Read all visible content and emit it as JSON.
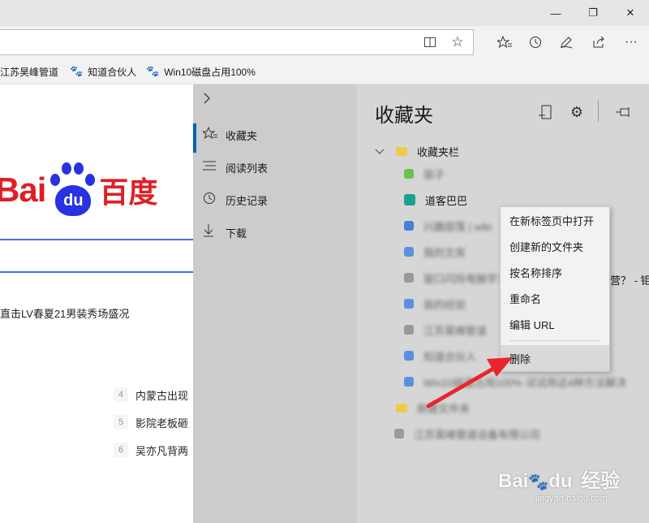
{
  "window": {
    "minimize_glyph": "—",
    "maximize_glyph": "❐",
    "close_glyph": "✕"
  },
  "toolbar": {
    "reading_view_glyph": "📖",
    "favorite_star_glyph": "☆",
    "favorites_glyph": "✩",
    "history_glyph": "🕘",
    "notes_glyph": "✎",
    "share_glyph": "⇪",
    "more_glyph": "···"
  },
  "favorites_bar": {
    "items": [
      {
        "label": "江苏昊峰管道",
        "icon": "baidu-paw-icon"
      },
      {
        "label": "知道合伙人",
        "icon": "baidu-paw-icon"
      },
      {
        "label": "Win10磁盘占用100%",
        "icon": "baidu-paw-icon"
      }
    ]
  },
  "page": {
    "logo_latin": "Bai",
    "logo_du": "du",
    "logo_cn": "百度",
    "news_line": "直击LV春夏21男装秀场盛况",
    "hot_list": [
      {
        "num": "4",
        "text": "内蒙古出现"
      },
      {
        "num": "5",
        "text": "影院老板砸"
      },
      {
        "num": "6",
        "text": "吴亦凡背两"
      }
    ]
  },
  "hub": {
    "expand_glyph": "›",
    "nav": [
      {
        "label": "收藏夹",
        "icon": "star-list-icon",
        "glyph": "☆"
      },
      {
        "label": "阅读列表",
        "icon": "reading-list-icon",
        "glyph": "☰"
      },
      {
        "label": "历史记录",
        "icon": "history-icon",
        "glyph": "↺"
      },
      {
        "label": "下载",
        "icon": "download-icon",
        "glyph": "↓"
      }
    ]
  },
  "favorites_pane": {
    "title": "收藏夹",
    "add_glyph": "⊞",
    "settings_glyph": "⚙",
    "pin_glyph": "⊣",
    "root_folder": "收藏夹栏",
    "items": [
      {
        "label": "丽子",
        "blurred": true,
        "color": "#6cc24a"
      },
      {
        "label": "道客巴巴",
        "blurred": false,
        "color": "#1aa38c"
      },
      {
        "label": "兴趣部落 | wiki",
        "blurred": true,
        "color": "#4a7fd4"
      },
      {
        "label": "我的文库",
        "blurred": true,
        "color": "#5a8fe0"
      },
      {
        "label": "窗口闪烁电脑学习网",
        "blurred": true,
        "color": "#9a9a9a"
      },
      {
        "label": "我的经验",
        "blurred": true,
        "color": "#5a8fe0"
      },
      {
        "label": "江苏昊峰管道",
        "blurred": true,
        "color": "#9a9a9a"
      },
      {
        "label": "知道合伙人",
        "blurred": true,
        "color": "#5a8fe0"
      },
      {
        "label": "Win10磁盘占用100% 试试用这4种方法解决",
        "blurred": true,
        "color": "#5a8fe0"
      },
      {
        "label": "新建文件夹",
        "blurred": true,
        "color": "#f3c94b"
      },
      {
        "label": "江苏昊峰管道设备有限公司",
        "blurred": true,
        "color": "#9a9a9a"
      }
    ]
  },
  "context_menu": {
    "items": [
      "在新标签页中打开",
      "创建新的文件夹",
      "按名称排序",
      "重命名",
      "编辑 URL",
      "删除"
    ]
  },
  "overflow_text": "营？ - 钜",
  "watermark": {
    "brand": "Bai",
    "brand2": "du",
    "label": "经验",
    "url": "jingyan.baidu.com"
  },
  "colors": {
    "accent": "#0063b1",
    "baidu_red": "#de1f26",
    "baidu_blue": "#2932e1",
    "arrow_red": "#e8262b"
  }
}
